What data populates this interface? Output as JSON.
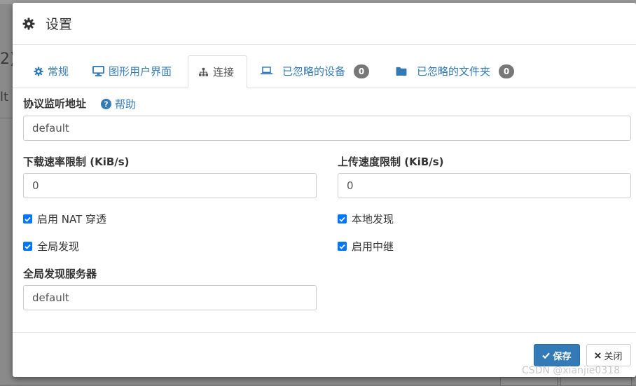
{
  "background": {
    "fragment_top": "2)",
    "fragment_mid": "lt"
  },
  "dialog": {
    "title": "设置",
    "tabs": [
      {
        "label": "常规",
        "icon": "gear-icon"
      },
      {
        "label": "图形用户界面",
        "icon": "desktop-icon"
      },
      {
        "label": "连接",
        "icon": "sitemap-icon",
        "active": true
      },
      {
        "label": "已忽略的设备",
        "icon": "laptop-icon",
        "badge": "0"
      },
      {
        "label": "已忽略的文件夹",
        "icon": "folder-icon",
        "badge": "0"
      }
    ],
    "listen_address": {
      "label": "协议监听地址",
      "help": "帮助",
      "value": "default"
    },
    "download_limit": {
      "label": "下载速率限制 (KiB/s)",
      "value": "0"
    },
    "upload_limit": {
      "label": "上传速度限制 (KiB/s)",
      "value": "0"
    },
    "checks": {
      "nat": {
        "label": "启用 NAT 穿透",
        "checked": true
      },
      "local_discovery": {
        "label": "本地发现",
        "checked": true
      },
      "global_discovery": {
        "label": "全局发现",
        "checked": true
      },
      "relaying": {
        "label": "启用中继",
        "checked": true
      }
    },
    "global_discovery_server": {
      "label": "全局发现服务器",
      "value": "default"
    },
    "footer": {
      "save": "保存",
      "close": "关闭"
    }
  },
  "watermark": "CSDN @xianjie0318",
  "colors": {
    "link": "#337ab7",
    "primary": "#337ab7",
    "badge": "#777777",
    "checkbox": "#0075ff"
  }
}
